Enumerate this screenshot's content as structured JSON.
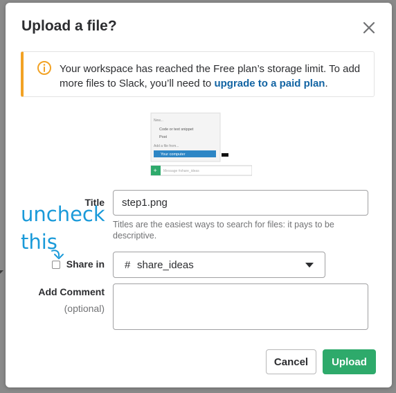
{
  "dialog": {
    "title": "Upload a file?",
    "close_icon": "close-icon"
  },
  "banner": {
    "icon": "info-icon",
    "message": "Your workspace has reached the Free plan’s storage limit. To add more files to Slack, you’ll need to ",
    "link_text": "upgrade to a paid plan",
    "suffix": ".",
    "accent_color": "#f2a224"
  },
  "preview": {
    "menu_items": [
      "New...",
      "Code or text snippet",
      "Post",
      "Add a file from...",
      "Your computer"
    ],
    "message_placeholder": "Message #share_ideas"
  },
  "form": {
    "title_label": "Title",
    "title_value": "step1.png",
    "title_hint": "Titles are the easiest ways to search for files: it pays to be descriptive.",
    "share_label": "Share in",
    "share_checked": false,
    "channel_hash": "#",
    "channel_value": "share_ideas",
    "comment_label": "Add Comment",
    "comment_optional": "(optional)",
    "comment_value": ""
  },
  "buttons": {
    "cancel": "Cancel",
    "upload": "Upload",
    "upload_color": "#2eaa6b"
  },
  "annotation": {
    "line1": "uncheck",
    "line2": "this",
    "color": "#1a9ad9"
  }
}
